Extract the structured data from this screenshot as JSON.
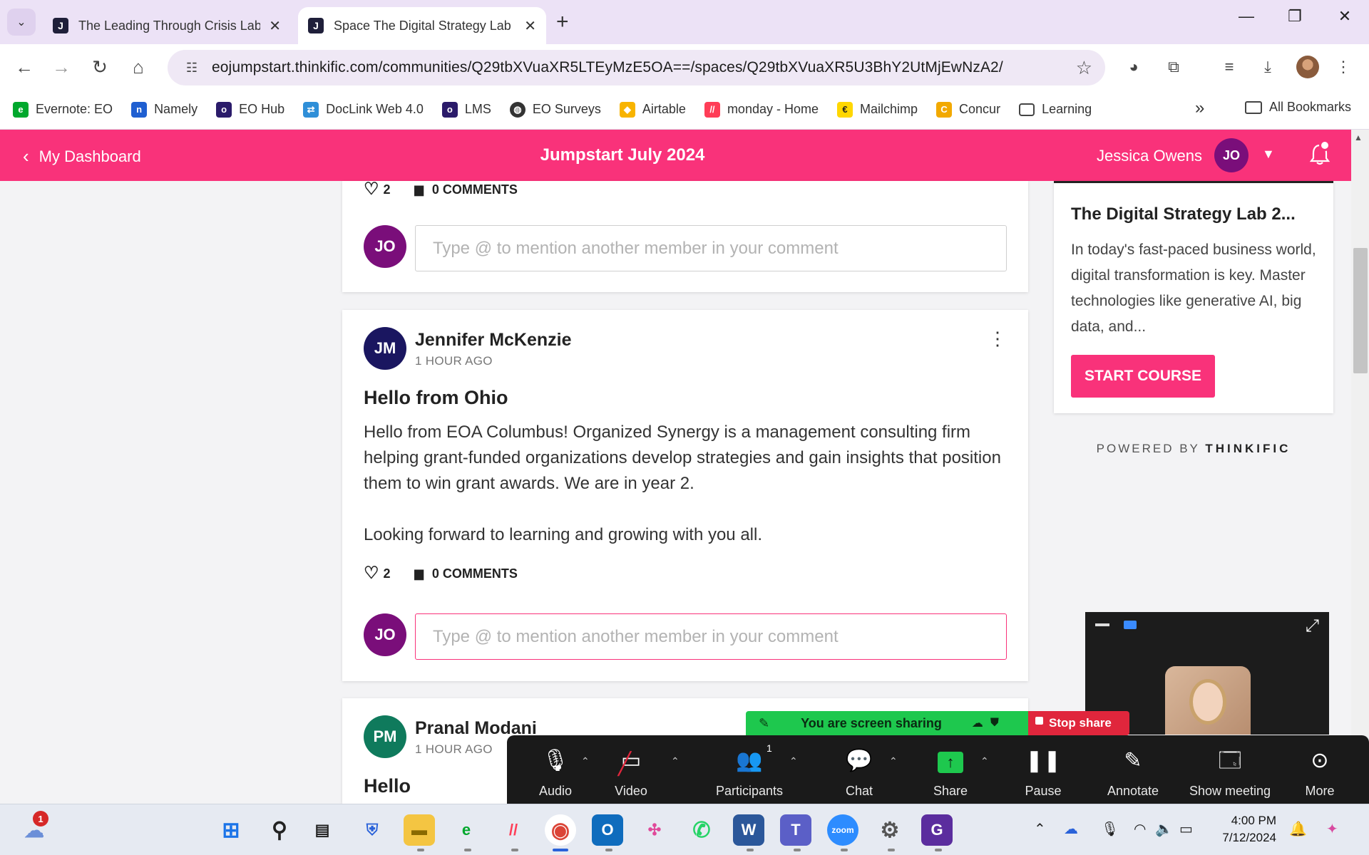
{
  "browser": {
    "tabs": [
      {
        "title": "The Leading Through Crisis Lab",
        "favicon": "J",
        "active": false
      },
      {
        "title": "Space The Digital Strategy Lab |",
        "favicon": "J",
        "active": true
      }
    ],
    "url": "eojumpstart.thinkific.com/communities/Q29tbXVuaXR5LTEyMzE5OA==/spaces/Q29tbXVuaXR5U3BhY2UtMjEwNzA2/",
    "bookmarks": [
      {
        "label": "Evernote: EO",
        "icon": "evernote-icon",
        "color": "#00a82d"
      },
      {
        "label": "Namely",
        "icon": "namely-icon",
        "color": "#1f5fd1"
      },
      {
        "label": "EO Hub",
        "icon": "eo-hub-icon",
        "color": "#2b1b6a"
      },
      {
        "label": "DocLink Web 4.0",
        "icon": "doclink-icon",
        "color": "#2f8fd8"
      },
      {
        "label": "LMS",
        "icon": "lms-icon",
        "color": "#2b1b6a"
      },
      {
        "label": "EO Surveys",
        "icon": "globe-icon",
        "color": "#333333"
      },
      {
        "label": "Airtable",
        "icon": "airtable-icon",
        "color": "#f8b400"
      },
      {
        "label": "monday - Home",
        "icon": "monday-icon",
        "color": "#ff3d57"
      },
      {
        "label": "Mailchimp",
        "icon": "mailchimp-icon",
        "color": "#ffd700"
      },
      {
        "label": "Concur",
        "icon": "concur-icon",
        "color": "#f2a900"
      },
      {
        "label": "Learning",
        "icon": "folder-icon",
        "color": "#444444"
      }
    ],
    "all_bookmarks": "All Bookmarks"
  },
  "header": {
    "back_label": "My Dashboard",
    "course_title": "Jumpstart July 2024",
    "user_name": "Jessica Owens",
    "user_initials": "JO"
  },
  "feed": {
    "comment_placeholder": "Type @ to mention another member in your comment",
    "commenter_initials": "JO",
    "posts": [
      {
        "likes": "2",
        "comments": "0 COMMENTS"
      },
      {
        "author": "Jennifer McKenzie",
        "initials": "JM",
        "avatar_color": "#1a1660",
        "time": "1 HOUR AGO",
        "title": "Hello from Ohio",
        "body": "Hello from EOA Columbus! Organized Synergy is a management consulting firm helping grant-funded organizations develop strategies and gain insights that position them to win grant awards. We are in year 2.\n\nLooking forward to learning and growing with you all.",
        "likes": "2",
        "comments": "0 COMMENTS"
      },
      {
        "author": "Pranal Modani",
        "initials": "PM",
        "avatar_color": "#0f7a5c",
        "time": "1 HOUR AGO",
        "title": "Hello"
      }
    ]
  },
  "sidebar": {
    "course_title": "The Digital Strategy Lab 2...",
    "course_desc": "In today's fast-paced business world, digital transformation is key. Master technologies like generative AI, big data, and...",
    "start_label": "START COURSE",
    "powered_prefix": "POWERED BY",
    "powered_brand": "THINKIFIC"
  },
  "zoom": {
    "sharing_text": "You are screen sharing",
    "stop_share": "Stop share",
    "participants_count": "1",
    "controls": [
      {
        "label": "Audio",
        "icon": "microphone-icon"
      },
      {
        "label": "Video",
        "icon": "video-off-icon"
      },
      {
        "label": "Participants",
        "icon": "participants-icon"
      },
      {
        "label": "Chat",
        "icon": "chat-icon"
      },
      {
        "label": "Share",
        "icon": "share-screen-icon"
      },
      {
        "label": "Pause",
        "icon": "pause-icon"
      },
      {
        "label": "Annotate",
        "icon": "pencil-icon"
      },
      {
        "label": "Show meeting",
        "icon": "show-meeting-icon"
      },
      {
        "label": "More",
        "icon": "more-icon"
      }
    ]
  },
  "taskbar": {
    "weather_badge": "1",
    "time": "4:00 PM",
    "date": "7/12/2024"
  },
  "colors": {
    "brand_pink": "#f9327a",
    "user_avatar": "#7a0e7a",
    "zoom_green": "#1ec84e",
    "zoom_red": "#e0263c"
  }
}
